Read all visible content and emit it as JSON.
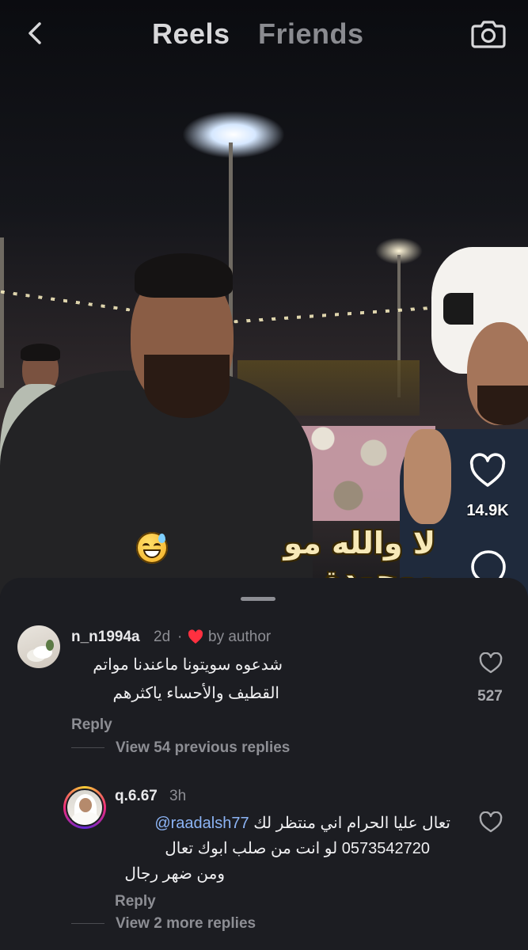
{
  "nav": {
    "tab_active": "Reels",
    "tab_inactive": "Friends"
  },
  "video": {
    "caption": "لا والله مو موجودة",
    "likes": "14.9K"
  },
  "comments": [
    {
      "username": "n_n1994a",
      "time": "2d",
      "separator": "·",
      "author_note": "by author",
      "lines": [
        "شدعوه سويتونا ماعندنا مواتم",
        "القطيف والأحساء ياكثرهم"
      ],
      "likes": "527",
      "reply_label": "Reply",
      "view_replies": "View 54 previous replies"
    },
    {
      "username": "q.6.67",
      "time": "3h",
      "mention": "@raadalsh77",
      "line1_text": "تعال عليا الحرام اني منتظر لك",
      "line2": "0573542720 لو انت من صلب ابوك تعال",
      "line3": "ومن ضهر رجال",
      "reply_label": "Reply",
      "view_replies": "View 2 more replies"
    }
  ],
  "colors": {
    "accent_heart": "#ff3040",
    "mention": "#8cb4f5",
    "sheet_bg": "#1c1d22"
  },
  "icons": [
    "back-icon",
    "camera-icon",
    "heart-icon",
    "comment-icon",
    "red-heart-icon"
  ]
}
